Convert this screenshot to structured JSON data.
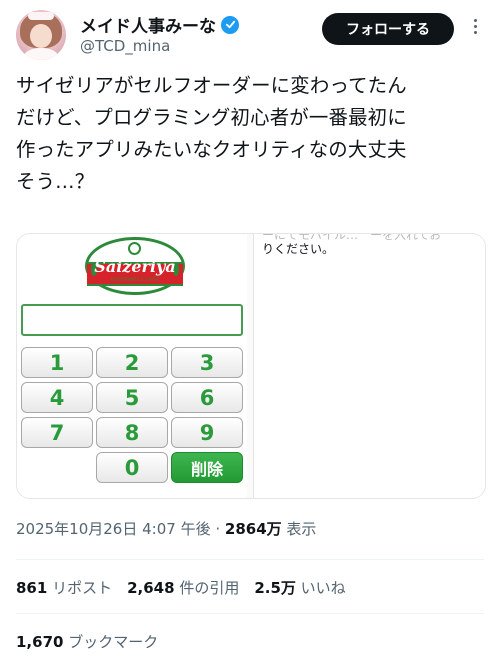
{
  "author": {
    "display_name": "メイド人事みーな",
    "handle": "@TCD_mina",
    "verified_icon": "verified-badge-icon",
    "verified_color": "#1d9bf0"
  },
  "actions": {
    "follow_label": "フォローする",
    "more_icon": "more-vertical-icon"
  },
  "tweet": {
    "text": "サイゼリアがセルフオーダーに変わってたん\nだけど、プログラミング初心者が一番最初に\n作ったアプリみたいなクオリティなの大丈夫\nそう…？"
  },
  "media": {
    "brand_name": "Saizeriya",
    "brand_sub": "RISTORANTE E CAFFE",
    "keypad": [
      "1",
      "2",
      "3",
      "4",
      "5",
      "6",
      "7",
      "8",
      "9",
      "0"
    ],
    "delete_label": "削除",
    "right_text_faded": "ーにてモバイル…　ーを入れてお",
    "right_text": "りください。"
  },
  "meta": {
    "timestamp": "2025年10月26日 4:07 午後",
    "separator": " · ",
    "views_count": "2864万",
    "views_label": " 表示"
  },
  "stats": {
    "reposts_count": "861",
    "reposts_label": " リポスト　",
    "quotes_count": "2,648",
    "quotes_label": " 件の引用　",
    "likes_count": "2.5万",
    "likes_label": " いいね"
  },
  "bookmarks": {
    "count": "1,670",
    "label": " ブックマーク"
  },
  "colors": {
    "accent_green": "#2a9b3a",
    "brand_red": "#d6222a",
    "text_secondary": "#536471"
  }
}
